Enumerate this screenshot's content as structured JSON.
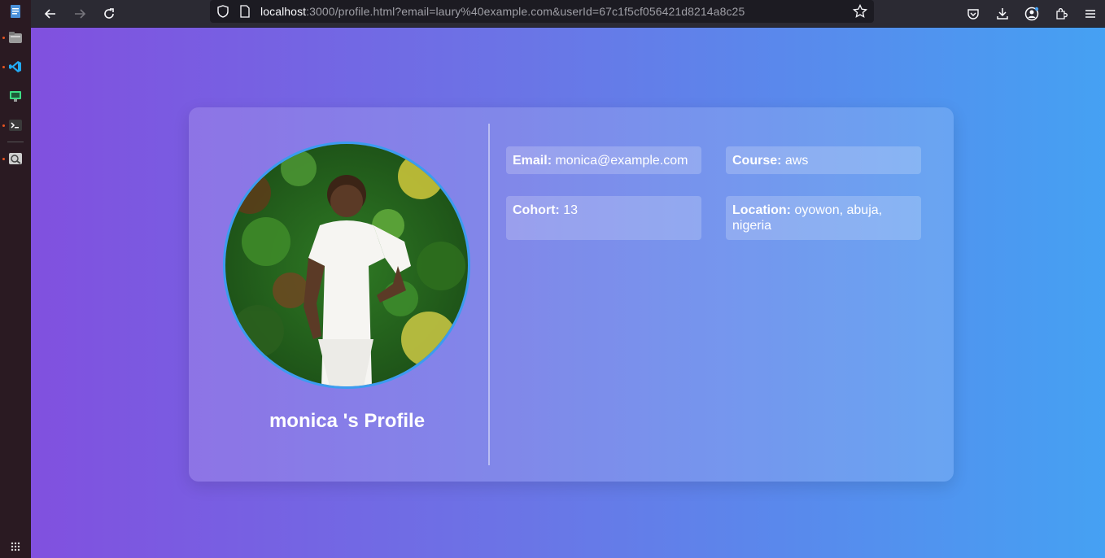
{
  "browser": {
    "url_host": "localhost",
    "url_rest": ":3000/profile.html?email=laury%40example.com&userId=67c1f5cf056421d8214a8c25"
  },
  "profile": {
    "title": "monica 's Profile",
    "fields": {
      "email_label": "Email:",
      "email_value": "monica@example.com",
      "course_label": "Course:",
      "course_value": "aws",
      "cohort_label": "Cohort:",
      "cohort_value": "13",
      "location_label": "Location:",
      "location_value": "oyowon, abuja, nigeria"
    }
  },
  "colors": {
    "gradient_start": "#8150df",
    "gradient_end": "#45a1f3",
    "avatar_border": "#3b9cf0"
  }
}
